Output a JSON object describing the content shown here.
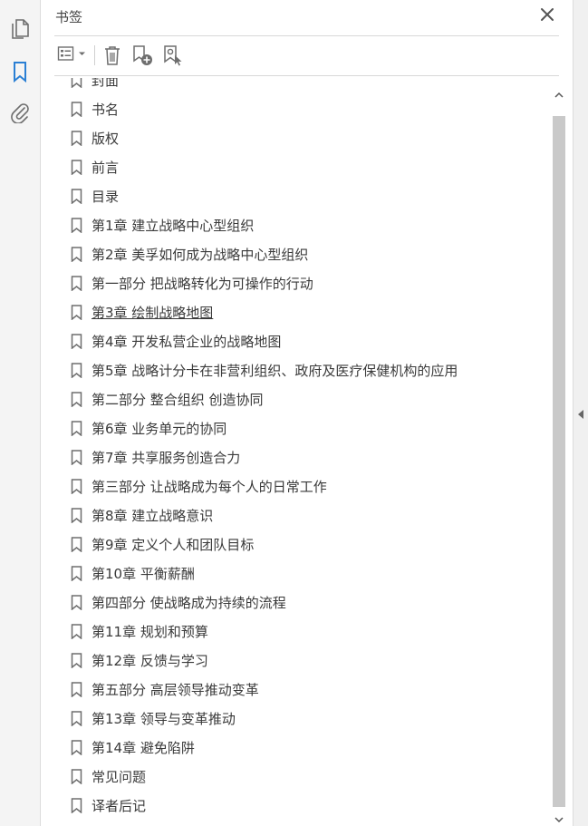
{
  "panel": {
    "title": "书签"
  },
  "bookmarks": [
    {
      "label": "封面"
    },
    {
      "label": "书名"
    },
    {
      "label": "版权"
    },
    {
      "label": "前言"
    },
    {
      "label": "目录"
    },
    {
      "label": "第1章  建立战略中心型组织"
    },
    {
      "label": "第2章  美孚如何成为战略中心型组织"
    },
    {
      "label": "第一部分  把战略转化为可操作的行动"
    },
    {
      "label": "第3章  绘制战略地图"
    },
    {
      "label": "第4章  开发私营企业的战略地图"
    },
    {
      "label": "第5章  战略计分卡在非营利组织、政府及医疗保健机构的应用"
    },
    {
      "label": "第二部分  整合组织  创造协同"
    },
    {
      "label": "第6章  业务单元的协同"
    },
    {
      "label": "第7章  共享服务创造合力"
    },
    {
      "label": "第三部分  让战略成为每个人的日常工作"
    },
    {
      "label": "第8章  建立战略意识"
    },
    {
      "label": "第9章  定义个人和团队目标"
    },
    {
      "label": "第10章  平衡薪酬"
    },
    {
      "label": "第四部分  使战略成为持续的流程"
    },
    {
      "label": "第11章  规划和预算"
    },
    {
      "label": "第12章  反馈与学习"
    },
    {
      "label": "第五部分  高层领导推动变革"
    },
    {
      "label": "第13章  领导与变革推动"
    },
    {
      "label": "第14章  避免陷阱"
    },
    {
      "label": "常见问题"
    },
    {
      "label": "译者后记"
    }
  ],
  "hovered_index": 8,
  "icons": {
    "rail": [
      "pages-icon",
      "bookmark-panel-icon",
      "attachment-icon"
    ],
    "toolbar": [
      "options-icon",
      "delete-icon",
      "new-bookmark-icon",
      "bookmark-from-structure-icon"
    ]
  },
  "colors": {
    "accent": "#2a7fd4",
    "icon": "#6e6e6e",
    "scroll_thumb": "#c9c9c9"
  }
}
